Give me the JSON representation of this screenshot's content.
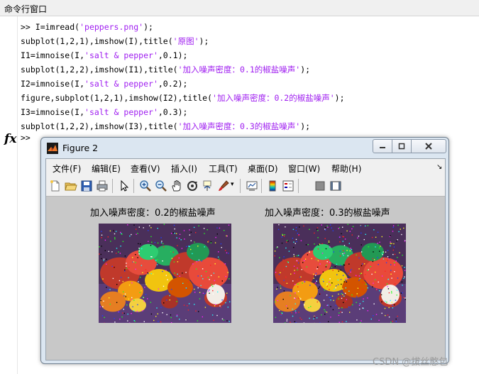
{
  "command_window": {
    "title": "命令行窗口",
    "lines": [
      [
        {
          "t": ">> I=imread(",
          "s": false
        },
        {
          "t": "'peppers.png'",
          "s": true
        },
        {
          "t": ");",
          "s": false
        }
      ],
      [
        {
          "t": "subplot(1,2,1),imshow(I),title(",
          "s": false
        },
        {
          "t": "'原图'",
          "s": true
        },
        {
          "t": ");",
          "s": false
        }
      ],
      [
        {
          "t": "I1=imnoise(I,",
          "s": false
        },
        {
          "t": "'salt & pepper'",
          "s": true
        },
        {
          "t": ",0.1);",
          "s": false
        }
      ],
      [
        {
          "t": "subplot(1,2,2),imshow(I1),title(",
          "s": false
        },
        {
          "t": "'加入噪声密度：0.1的椒盐噪声'",
          "s": true
        },
        {
          "t": ");",
          "s": false
        }
      ],
      [
        {
          "t": "I2=imnoise(I,",
          "s": false
        },
        {
          "t": "'salt & pepper'",
          "s": true
        },
        {
          "t": ",0.2);",
          "s": false
        }
      ],
      [
        {
          "t": "figure,subplot(1,2,1),imshow(I2),title(",
          "s": false
        },
        {
          "t": "'加入噪声密度：0.2的椒盐噪声'",
          "s": true
        },
        {
          "t": ");",
          "s": false
        }
      ],
      [
        {
          "t": "I3=imnoise(I,",
          "s": false
        },
        {
          "t": "'salt & pepper'",
          "s": true
        },
        {
          "t": ",0.3);",
          "s": false
        }
      ],
      [
        {
          "t": "subplot(1,2,2),imshow(I3),title(",
          "s": false
        },
        {
          "t": "'加入噪声密度：0.3的椒盐噪声'",
          "s": true
        },
        {
          "t": ");",
          "s": false
        }
      ]
    ],
    "fx_label": "fx",
    "prompt": ">>"
  },
  "figure": {
    "title": "Figure 2",
    "menu": [
      "文件(F)",
      "编辑(E)",
      "查看(V)",
      "插入(I)",
      "工具(T)",
      "桌面(D)",
      "窗口(W)",
      "帮助(H)"
    ],
    "toolbar_icons": [
      "new-file-icon",
      "open-folder-icon",
      "save-icon",
      "print-icon",
      "pointer-icon",
      "zoom-in-icon",
      "zoom-out-icon",
      "pan-hand-icon",
      "rotate-3d-icon",
      "data-cursor-icon",
      "brush-icon",
      "link-plot-icon",
      "colorbar-icon",
      "legend-icon",
      "hide-plot-tools-icon",
      "show-plot-tools-icon"
    ],
    "plots": [
      {
        "title": "加入噪声密度：0.2的椒盐噪声",
        "noise_density": 0.2
      },
      {
        "title": "加入噪声密度：0.3的椒盐噪声",
        "noise_density": 0.3
      }
    ]
  },
  "colors": {
    "string": "#a020f0"
  },
  "watermark": "CSDN @拔丝憨包"
}
